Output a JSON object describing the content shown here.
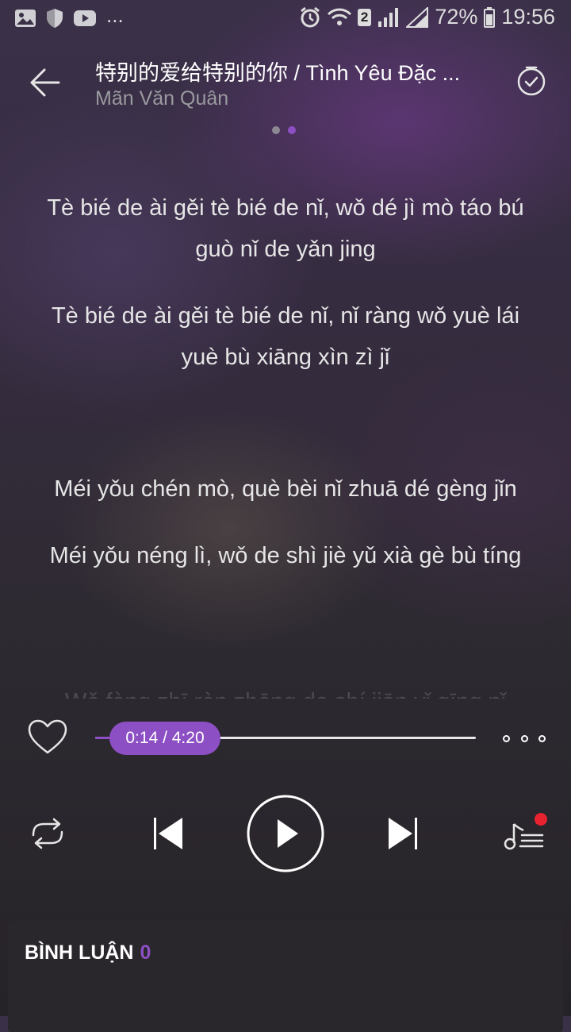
{
  "status_bar": {
    "left_icons": [
      "gallery-icon",
      "shield-icon",
      "youtube-icon"
    ],
    "overflow": "...",
    "sim_badge": "2",
    "battery": "72%",
    "time": "19:56"
  },
  "header": {
    "title": "特别的爱给特别的你 / Tình Yêu Đặc ...",
    "artist": "Mãn Văn Quân",
    "back_icon": "back-arrow-icon",
    "timer_icon": "timer-icon"
  },
  "pager": {
    "count": 2,
    "active_index": 1
  },
  "lyrics": [
    "Tè bié de ài gěi tè bié de nǐ, wǒ dé jì mò táo bú guò nǐ de yǎn jing",
    "Tè bié de ài gěi tè bié de nǐ, nǐ ràng wǒ yuè lái yuè bù xiāng xìn zì jǐ",
    "Méi yǒu chén mò, què bèi nǐ zhuā dé gèng jǐn",
    "Méi yǒu néng lì, wǒ de shì jiè yǔ xià gè bù tíng",
    "Wǒ fàng zhī rèn zhōng de shí jiān yǐ qīng nǐ"
  ],
  "player": {
    "current_time": "0:14",
    "total_time": "4:20",
    "time_display": "0:14 / 4:20",
    "progress": 0.054,
    "accent_color": "#8d4fc4",
    "icons": [
      "heart-icon",
      "more-icon",
      "repeat-icon",
      "previous-icon",
      "play-icon",
      "next-icon",
      "playlist-icon"
    ],
    "playlist_has_notification": true
  },
  "comments": {
    "title": "BÌNH LUẬN",
    "count": "0"
  }
}
